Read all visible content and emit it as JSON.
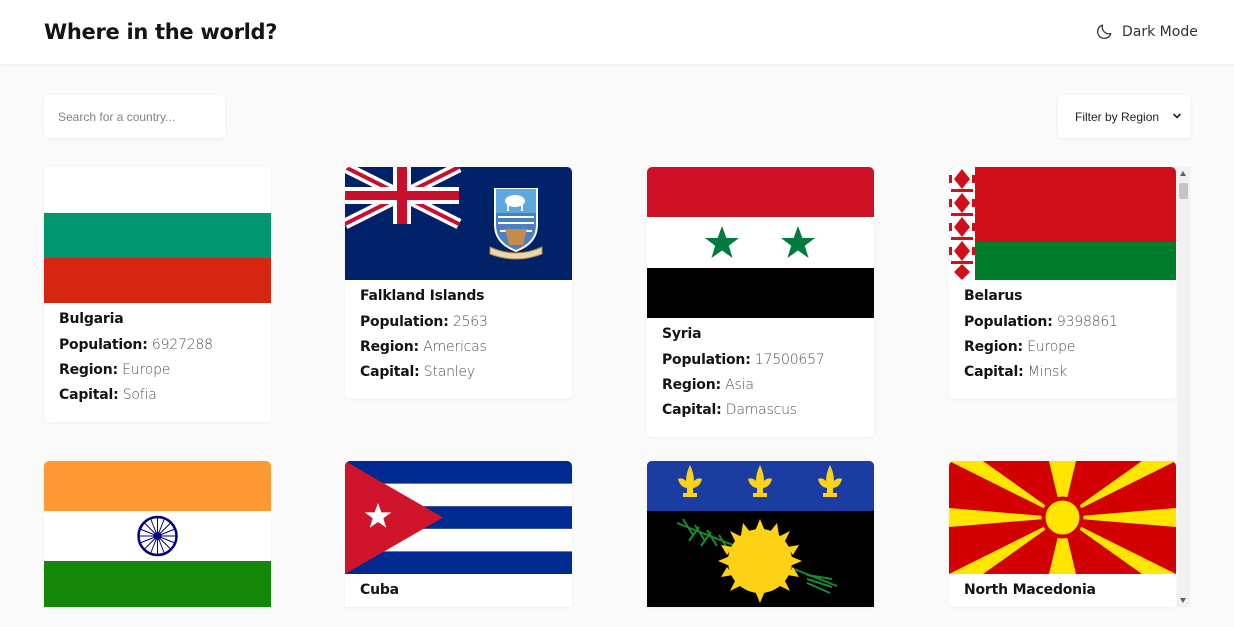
{
  "header": {
    "title": "Where in the world?",
    "dark_mode_label": "Dark Mode",
    "dark_mode_icon": "moon-icon"
  },
  "search": {
    "placeholder": "Search for a country..."
  },
  "filter": {
    "label": "Filter by Region",
    "icon": "chevron-down-icon"
  },
  "labels": {
    "population": "Population:",
    "region": "Region:",
    "capital": "Capital:"
  },
  "countries": [
    {
      "name": "Bulgaria",
      "population": "6927288",
      "region": "Europe",
      "capital": "Sofia",
      "flag": "flag-bulgaria"
    },
    {
      "name": "Falkland Islands",
      "population": "2563",
      "region": "Americas",
      "capital": "Stanley",
      "flag": "flag-falkland-islands"
    },
    {
      "name": "Syria",
      "population": "17500657",
      "region": "Asia",
      "capital": "Damascus",
      "flag": "flag-syria"
    },
    {
      "name": "Belarus",
      "population": "9398861",
      "region": "Europe",
      "capital": "Minsk",
      "flag": "flag-belarus"
    },
    {
      "name": "",
      "flag": "flag-india"
    },
    {
      "name": "Cuba",
      "flag": "flag-cuba"
    },
    {
      "name": "",
      "flag": "flag-guadeloupe"
    },
    {
      "name": "North Macedonia",
      "flag": "flag-north-macedonia"
    }
  ],
  "colors": {
    "background": "#fafafa",
    "card": "#ffffff",
    "text": "#111517",
    "muted": "#555555"
  }
}
